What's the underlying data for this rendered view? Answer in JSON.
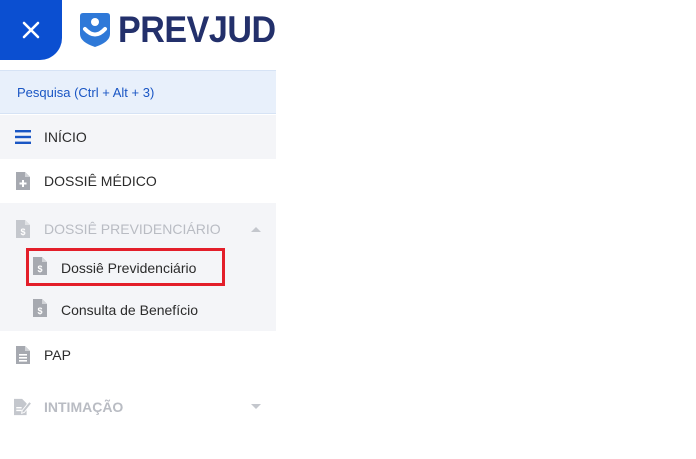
{
  "header": {
    "close_icon": "close-icon",
    "logo_text": "PREVJUD",
    "logo_icon": "prevjud-shield-icon"
  },
  "search": {
    "label": "Pesquisa (Ctrl + Alt + 3)"
  },
  "menu": {
    "inicio": {
      "label": "INÍCIO",
      "icon": "hamburger-icon"
    },
    "dossie_medico": {
      "label": "DOSSIÊ MÉDICO",
      "icon": "medical-document-icon"
    },
    "dossie_previdenciario": {
      "label": "DOSSIÊ PREVIDENCIÁRIO",
      "icon": "money-document-icon",
      "expanded": true,
      "children": [
        {
          "label": "Dossiê Previdenciário",
          "icon": "money-document-icon",
          "highlighted": true
        },
        {
          "label": "Consulta de Benefício",
          "icon": "money-document-icon"
        }
      ]
    },
    "pap": {
      "label": "PAP",
      "icon": "document-icon"
    },
    "intimacao": {
      "label": "INTIMAÇÃO",
      "icon": "edit-document-icon",
      "expanded": false
    }
  },
  "colors": {
    "accent": "#0b4fd1",
    "brand_text": "#23306b",
    "highlight_border": "#e31e2a",
    "search_bg": "#e8f0fb",
    "disabled_text": "#b9bcc3"
  }
}
